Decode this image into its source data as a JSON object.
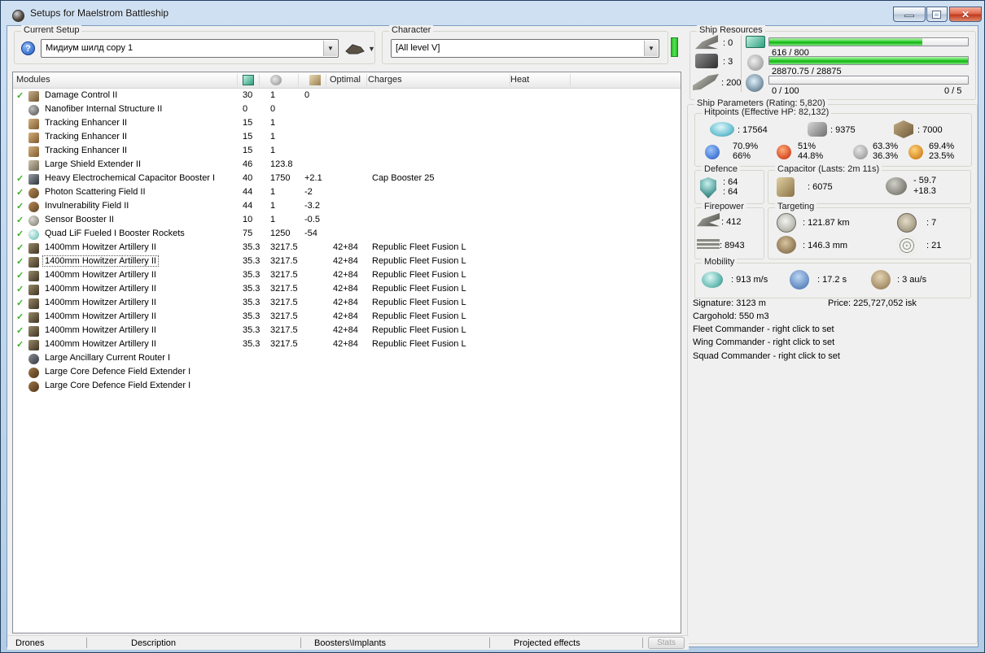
{
  "window": {
    "title": "Setups for Maelstrom Battleship"
  },
  "toolbar": {
    "current_setup_label": "Current Setup",
    "current_setup_value": "Мидиум шилд copy 1",
    "character_label": "Character",
    "character_value": "[All level V]"
  },
  "ship_resources": {
    "title": "Ship Resources",
    "turret_hardpoints": ": 0",
    "launcher_hardpoints": ": 3",
    "calibration": ": 200",
    "cpu": {
      "text": "616 / 800",
      "pct": 77
    },
    "powergrid": {
      "text": "28870.75 / 28875",
      "pct": 100
    },
    "drones": {
      "text": "0 / 100",
      "right": "0 / 5",
      "pct": 0
    }
  },
  "ship_parameters": {
    "title": "Ship Parameters (Rating: 5,820)",
    "hitpoints": {
      "title": "Hitpoints (Effective HP: 82,132)",
      "shield": ": 17564",
      "armor": ": 9375",
      "structure": ": 7000",
      "resists": [
        {
          "name": "em",
          "shield": "70.9%",
          "armor": "66%"
        },
        {
          "name": "thermal",
          "shield": "51%",
          "armor": "44.8%"
        },
        {
          "name": "kinetic",
          "shield": "63.3%",
          "armor": "36.3%"
        },
        {
          "name": "explosive",
          "shield": "69.4%",
          "armor": "23.5%"
        }
      ]
    },
    "defence": {
      "title": "Defence",
      "line1": ": 64",
      "line2": ": 64"
    },
    "capacitor": {
      "title": "Capacitor (Lasts: 2m 11s)",
      "amount": ": 6075",
      "drain": "- 59.7",
      "recharge": "+18.3"
    },
    "firepower": {
      "title": "Firepower",
      "volley": ": 412",
      "dps": ": 8943"
    },
    "targeting": {
      "title": "Targeting",
      "range": ": 121.87 km",
      "scan_res": ": 146.3 mm",
      "max_targets": ": 7",
      "sensor_strength": ": 21"
    },
    "mobility": {
      "title": "Mobility",
      "speed": ": 913 m/s",
      "align": ": 17.2 s",
      "warp": ": 3 au/s"
    },
    "info": {
      "signature": "Signature: 3123 m",
      "price": "Price: 225,727,052 isk",
      "cargohold": "Cargohold: 550 m3",
      "fleet": "Fleet Commander - right click to set",
      "wing": "Wing Commander - right click to set",
      "squad": "Squad Commander - right click to set"
    }
  },
  "modules": {
    "headers": {
      "name": "Modules",
      "optimal": "Optimal",
      "charges": "Charges",
      "heat": "Heat"
    },
    "rows": [
      {
        "checked": true,
        "icon": "damage-control",
        "name": "Damage Control II",
        "cpu": "30",
        "pg": "1",
        "cap": "0",
        "optimal": "",
        "charges": ""
      },
      {
        "checked": false,
        "icon": "nanofiber",
        "name": "Nanofiber Internal Structure II",
        "cpu": "0",
        "pg": "0",
        "cap": "",
        "optimal": "",
        "charges": ""
      },
      {
        "checked": false,
        "icon": "tracking-enhancer",
        "name": "Tracking Enhancer II",
        "cpu": "15",
        "pg": "1",
        "cap": "",
        "optimal": "",
        "charges": ""
      },
      {
        "checked": false,
        "icon": "tracking-enhancer",
        "name": "Tracking Enhancer II",
        "cpu": "15",
        "pg": "1",
        "cap": "",
        "optimal": "",
        "charges": ""
      },
      {
        "checked": false,
        "icon": "tracking-enhancer",
        "name": "Tracking Enhancer II",
        "cpu": "15",
        "pg": "1",
        "cap": "",
        "optimal": "",
        "charges": ""
      },
      {
        "checked": false,
        "icon": "shield-extender",
        "name": "Large Shield Extender II",
        "cpu": "46",
        "pg": "123.8",
        "cap": "",
        "optimal": "",
        "charges": ""
      },
      {
        "checked": true,
        "icon": "cap-booster",
        "name": "Heavy Electrochemical Capacitor Booster I",
        "cpu": "40",
        "pg": "1750",
        "cap": "+2.1",
        "optimal": "",
        "charges": "Cap Booster 25"
      },
      {
        "checked": true,
        "icon": "hardener",
        "name": "Photon Scattering Field II",
        "cpu": "44",
        "pg": "1",
        "cap": "-2",
        "optimal": "",
        "charges": ""
      },
      {
        "checked": true,
        "icon": "hardener",
        "name": "Invulnerability Field II",
        "cpu": "44",
        "pg": "1",
        "cap": "-3.2",
        "optimal": "",
        "charges": ""
      },
      {
        "checked": true,
        "icon": "sensor-booster",
        "name": "Sensor Booster II",
        "cpu": "10",
        "pg": "1",
        "cap": "-0.5",
        "optimal": "",
        "charges": ""
      },
      {
        "checked": true,
        "icon": "mwd",
        "name": "Quad LiF Fueled I Booster Rockets",
        "cpu": "75",
        "pg": "1250",
        "cap": "-54",
        "optimal": "",
        "charges": ""
      },
      {
        "checked": true,
        "icon": "artillery",
        "name": "1400mm Howitzer Artillery II",
        "cpu": "35.3",
        "pg": "3217.5",
        "cap": "",
        "optimal": "42+84",
        "charges": "Republic Fleet Fusion L"
      },
      {
        "checked": true,
        "icon": "artillery",
        "name": "1400mm Howitzer Artillery II",
        "cpu": "35.3",
        "pg": "3217.5",
        "cap": "",
        "optimal": "42+84",
        "charges": "Republic Fleet Fusion L",
        "selected": true
      },
      {
        "checked": true,
        "icon": "artillery",
        "name": "1400mm Howitzer Artillery II",
        "cpu": "35.3",
        "pg": "3217.5",
        "cap": "",
        "optimal": "42+84",
        "charges": "Republic Fleet Fusion L"
      },
      {
        "checked": true,
        "icon": "artillery",
        "name": "1400mm Howitzer Artillery II",
        "cpu": "35.3",
        "pg": "3217.5",
        "cap": "",
        "optimal": "42+84",
        "charges": "Republic Fleet Fusion L"
      },
      {
        "checked": true,
        "icon": "artillery",
        "name": "1400mm Howitzer Artillery II",
        "cpu": "35.3",
        "pg": "3217.5",
        "cap": "",
        "optimal": "42+84",
        "charges": "Republic Fleet Fusion L"
      },
      {
        "checked": true,
        "icon": "artillery",
        "name": "1400mm Howitzer Artillery II",
        "cpu": "35.3",
        "pg": "3217.5",
        "cap": "",
        "optimal": "42+84",
        "charges": "Republic Fleet Fusion L"
      },
      {
        "checked": true,
        "icon": "artillery",
        "name": "1400mm Howitzer Artillery II",
        "cpu": "35.3",
        "pg": "3217.5",
        "cap": "",
        "optimal": "42+84",
        "charges": "Republic Fleet Fusion L"
      },
      {
        "checked": true,
        "icon": "artillery",
        "name": "1400mm Howitzer Artillery II",
        "cpu": "35.3",
        "pg": "3217.5",
        "cap": "",
        "optimal": "42+84",
        "charges": "Republic Fleet Fusion L"
      },
      {
        "checked": false,
        "icon": "rig-router",
        "name": "Large Ancillary Current Router I",
        "cpu": "",
        "pg": "",
        "cap": "",
        "optimal": "",
        "charges": ""
      },
      {
        "checked": false,
        "icon": "rig-extender",
        "name": "Large Core Defence Field Extender I",
        "cpu": "",
        "pg": "",
        "cap": "",
        "optimal": "",
        "charges": ""
      },
      {
        "checked": false,
        "icon": "rig-extender",
        "name": "Large Core Defence Field Extender I",
        "cpu": "",
        "pg": "",
        "cap": "",
        "optimal": "",
        "charges": ""
      }
    ]
  },
  "bottom": {
    "tabs": [
      "Drones",
      "Description",
      "Boosters\\Implants",
      "Projected effects"
    ],
    "stats_button": "Stats"
  },
  "colors": {
    "progress_green": "#3bd43b",
    "activity_green": "#3bd33b",
    "check_green": "#3fae2a",
    "close_red": "#c03a20"
  }
}
